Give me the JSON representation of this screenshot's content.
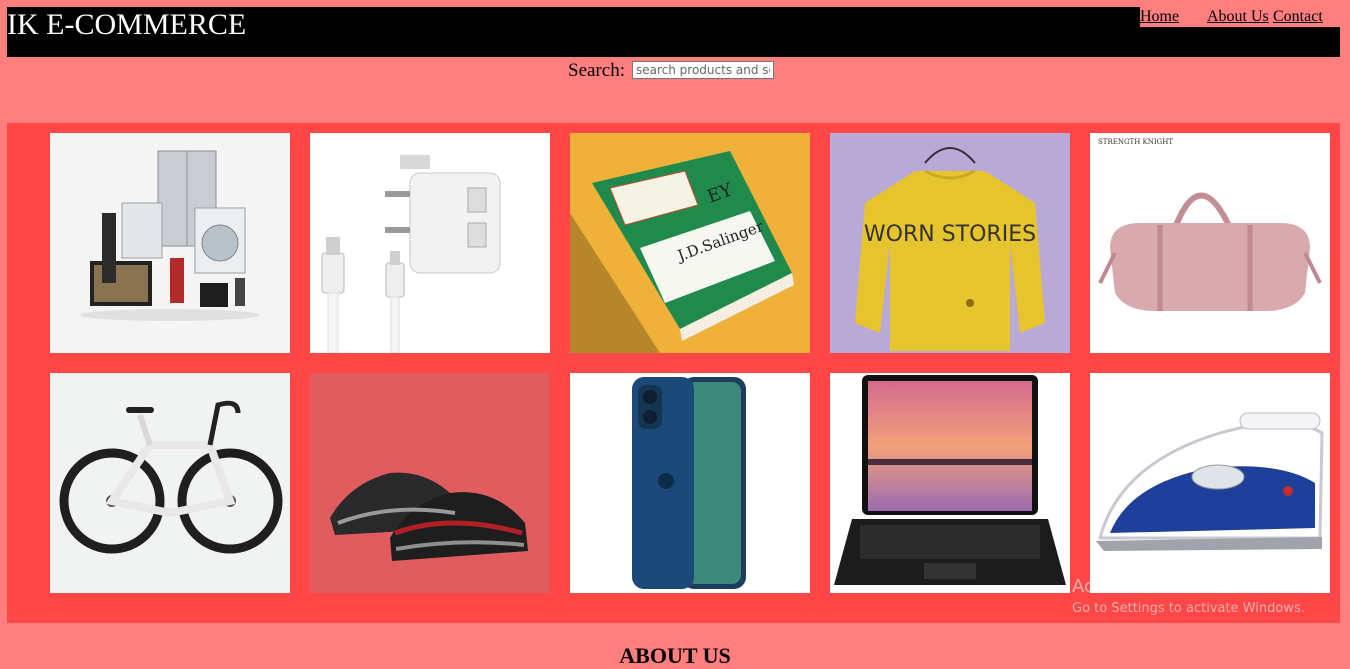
{
  "header": {
    "brand": "IK E-COMMERCE"
  },
  "nav": {
    "home": "Home",
    "about": "About Us",
    "contact": "Contact"
  },
  "search": {
    "label": "Search:",
    "placeholder": "search products and services"
  },
  "products": [
    {
      "icon": "home-appliances-image"
    },
    {
      "icon": "usb-charger-image"
    },
    {
      "icon": "book-image",
      "book_author": "J.D.Salinger",
      "book_title_fragment": "EY"
    },
    {
      "icon": "sweater-image",
      "shirt_text": "WORN STORIES"
    },
    {
      "icon": "duffel-bag-image",
      "brand_text": "STRENGTH KNIGHT"
    },
    {
      "icon": "bicycle-image"
    },
    {
      "icon": "sneakers-image"
    },
    {
      "icon": "smartphone-image"
    },
    {
      "icon": "laptop-image"
    },
    {
      "icon": "steam-iron-image"
    }
  ],
  "watermark": {
    "line1": "Activate Windows",
    "line2": "Go to Settings to activate Windows."
  },
  "about_heading": "ABOUT US"
}
